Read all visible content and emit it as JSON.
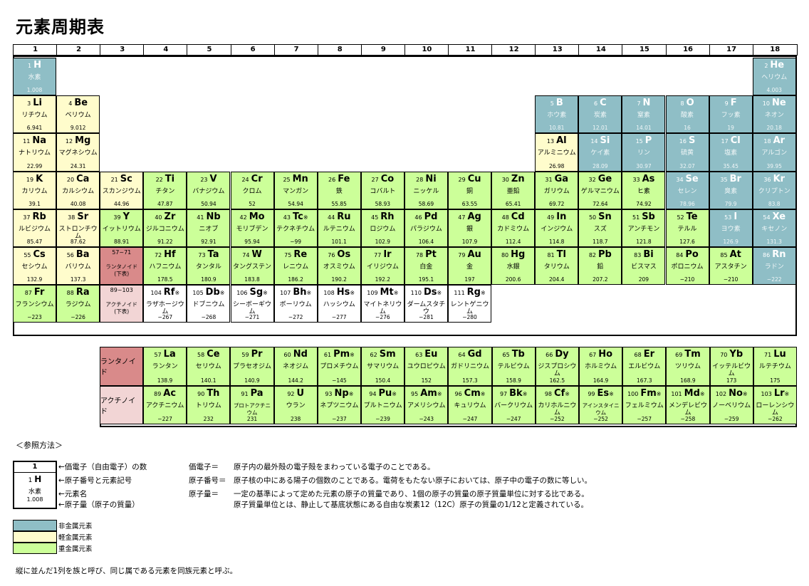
{
  "title": "元素周期表",
  "groups": [
    "1",
    "2",
    "3",
    "4",
    "5",
    "6",
    "7",
    "8",
    "9",
    "10",
    "11",
    "12",
    "13",
    "14",
    "15",
    "16",
    "17",
    "18"
  ],
  "main_elements": [
    {
      "n": "1",
      "s": "H",
      "name": "水素",
      "mass": "1.008",
      "cat": "nonmetal",
      "r": 0,
      "c": 0
    },
    {
      "n": "2",
      "s": "He",
      "name": "ヘリウム",
      "mass": "4.003",
      "cat": "nonmetal",
      "r": 0,
      "c": 17
    },
    {
      "n": "3",
      "s": "Li",
      "name": "リチウム",
      "mass": "6.941",
      "cat": "light",
      "r": 1,
      "c": 0
    },
    {
      "n": "4",
      "s": "Be",
      "name": "ベリウム",
      "mass": "9.012",
      "cat": "light",
      "r": 1,
      "c": 1
    },
    {
      "n": "5",
      "s": "B",
      "name": "ホウ素",
      "mass": "10.81",
      "cat": "nonmetal",
      "r": 1,
      "c": 12
    },
    {
      "n": "6",
      "s": "C",
      "name": "炭素",
      "mass": "12.01",
      "cat": "nonmetal",
      "r": 1,
      "c": 13
    },
    {
      "n": "7",
      "s": "N",
      "name": "窒素",
      "mass": "14.01",
      "cat": "nonmetal",
      "r": 1,
      "c": 14
    },
    {
      "n": "8",
      "s": "O",
      "name": "酸素",
      "mass": "16",
      "cat": "nonmetal",
      "r": 1,
      "c": 15
    },
    {
      "n": "9",
      "s": "F",
      "name": "フッ素",
      "mass": "19",
      "cat": "nonmetal",
      "r": 1,
      "c": 16
    },
    {
      "n": "10",
      "s": "Ne",
      "name": "ネオン",
      "mass": "20.18",
      "cat": "nonmetal",
      "r": 1,
      "c": 17
    },
    {
      "n": "11",
      "s": "Na",
      "name": "ナトリウム",
      "mass": "22.99",
      "cat": "light",
      "r": 2,
      "c": 0
    },
    {
      "n": "12",
      "s": "Mg",
      "name": "マグネシウム",
      "mass": "24.31",
      "cat": "light",
      "r": 2,
      "c": 1
    },
    {
      "n": "13",
      "s": "Al",
      "name": "アルミニウム",
      "mass": "26.98",
      "cat": "light",
      "r": 2,
      "c": 12
    },
    {
      "n": "14",
      "s": "Si",
      "name": "ケイ素",
      "mass": "28.09",
      "cat": "nonmetal",
      "r": 2,
      "c": 13
    },
    {
      "n": "15",
      "s": "P",
      "name": "リン",
      "mass": "30.97",
      "cat": "nonmetal",
      "r": 2,
      "c": 14
    },
    {
      "n": "16",
      "s": "S",
      "name": "硫黄",
      "mass": "32.07",
      "cat": "nonmetal",
      "r": 2,
      "c": 15
    },
    {
      "n": "17",
      "s": "Cl",
      "name": "塩素",
      "mass": "35.45",
      "cat": "nonmetal",
      "r": 2,
      "c": 16
    },
    {
      "n": "18",
      "s": "Ar",
      "name": "アルゴン",
      "mass": "39.95",
      "cat": "nonmetal",
      "r": 2,
      "c": 17
    },
    {
      "n": "19",
      "s": "K",
      "name": "カリウム",
      "mass": "39.1",
      "cat": "light",
      "r": 3,
      "c": 0
    },
    {
      "n": "20",
      "s": "Ca",
      "name": "カルシウム",
      "mass": "40.08",
      "cat": "light",
      "r": 3,
      "c": 1
    },
    {
      "n": "21",
      "s": "Sc",
      "name": "スカンジウム",
      "mass": "44.96",
      "cat": "light",
      "r": 3,
      "c": 2
    },
    {
      "n": "22",
      "s": "Ti",
      "name": "チタン",
      "mass": "47.87",
      "cat": "heavy",
      "r": 3,
      "c": 3
    },
    {
      "n": "23",
      "s": "V",
      "name": "バナジウム",
      "mass": "50.94",
      "cat": "heavy",
      "r": 3,
      "c": 4
    },
    {
      "n": "24",
      "s": "Cr",
      "name": "クロム",
      "mass": "52",
      "cat": "heavy",
      "r": 3,
      "c": 5
    },
    {
      "n": "25",
      "s": "Mn",
      "name": "マンガン",
      "mass": "54.94",
      "cat": "heavy",
      "r": 3,
      "c": 6
    },
    {
      "n": "26",
      "s": "Fe",
      "name": "鉄",
      "mass": "55.85",
      "cat": "heavy",
      "r": 3,
      "c": 7
    },
    {
      "n": "27",
      "s": "Co",
      "name": "コバルト",
      "mass": "58.93",
      "cat": "heavy",
      "r": 3,
      "c": 8
    },
    {
      "n": "28",
      "s": "Ni",
      "name": "ニッケル",
      "mass": "58.69",
      "cat": "heavy",
      "r": 3,
      "c": 9
    },
    {
      "n": "29",
      "s": "Cu",
      "name": "銅",
      "mass": "63.55",
      "cat": "heavy",
      "r": 3,
      "c": 10
    },
    {
      "n": "30",
      "s": "Zn",
      "name": "亜鉛",
      "mass": "65.41",
      "cat": "heavy",
      "r": 3,
      "c": 11
    },
    {
      "n": "31",
      "s": "Ga",
      "name": "ガリウム",
      "mass": "69.72",
      "cat": "heavy",
      "r": 3,
      "c": 12
    },
    {
      "n": "32",
      "s": "Ge",
      "name": "ゲルマニウム",
      "mass": "72.64",
      "cat": "heavy",
      "r": 3,
      "c": 13
    },
    {
      "n": "33",
      "s": "As",
      "name": "ヒ素",
      "mass": "74.92",
      "cat": "heavy",
      "r": 3,
      "c": 14
    },
    {
      "n": "34",
      "s": "Se",
      "name": "セレン",
      "mass": "78.96",
      "cat": "nonmetal",
      "r": 3,
      "c": 15
    },
    {
      "n": "35",
      "s": "Br",
      "name": "臭素",
      "mass": "79.9",
      "cat": "nonmetal",
      "r": 3,
      "c": 16
    },
    {
      "n": "36",
      "s": "Kr",
      "name": "クリプトン",
      "mass": "83.8",
      "cat": "nonmetal",
      "r": 3,
      "c": 17
    },
    {
      "n": "37",
      "s": "Rb",
      "name": "ルビジウム",
      "mass": "85.47",
      "cat": "light",
      "r": 4,
      "c": 0
    },
    {
      "n": "38",
      "s": "Sr",
      "name": "ストロンチウム",
      "mass": "87.62",
      "cat": "light",
      "r": 4,
      "c": 1
    },
    {
      "n": "39",
      "s": "Y",
      "name": "イットリウム",
      "mass": "88.91",
      "cat": "heavy",
      "r": 4,
      "c": 2
    },
    {
      "n": "40",
      "s": "Zr",
      "name": "ジルコニウム",
      "mass": "91.22",
      "cat": "heavy",
      "r": 4,
      "c": 3
    },
    {
      "n": "41",
      "s": "Nb",
      "name": "ニオブ",
      "mass": "92.91",
      "cat": "heavy",
      "r": 4,
      "c": 4
    },
    {
      "n": "42",
      "s": "Mo",
      "name": "モリブデン",
      "mass": "95.94",
      "cat": "heavy",
      "r": 4,
      "c": 5
    },
    {
      "n": "43",
      "s": "Tc",
      "mark": "※",
      "name": "テクネチウム",
      "mass": "−99",
      "cat": "heavy",
      "r": 4,
      "c": 6
    },
    {
      "n": "44",
      "s": "Ru",
      "name": "ルテニウム",
      "mass": "101.1",
      "cat": "heavy",
      "r": 4,
      "c": 7
    },
    {
      "n": "45",
      "s": "Rh",
      "name": "ロジウム",
      "mass": "102.9",
      "cat": "heavy",
      "r": 4,
      "c": 8
    },
    {
      "n": "46",
      "s": "Pd",
      "name": "パラジウム",
      "mass": "106.4",
      "cat": "heavy",
      "r": 4,
      "c": 9
    },
    {
      "n": "47",
      "s": "Ag",
      "name": "銀",
      "mass": "107.9",
      "cat": "heavy",
      "r": 4,
      "c": 10
    },
    {
      "n": "48",
      "s": "Cd",
      "name": "カドミウム",
      "mass": "112.4",
      "cat": "heavy",
      "r": 4,
      "c": 11
    },
    {
      "n": "49",
      "s": "In",
      "name": "インジウム",
      "mass": "114.8",
      "cat": "heavy",
      "r": 4,
      "c": 12
    },
    {
      "n": "50",
      "s": "Sn",
      "name": "スズ",
      "mass": "118.7",
      "cat": "heavy",
      "r": 4,
      "c": 13
    },
    {
      "n": "51",
      "s": "Sb",
      "name": "アンチモン",
      "mass": "121.8",
      "cat": "heavy",
      "r": 4,
      "c": 14
    },
    {
      "n": "52",
      "s": "Te",
      "name": "テルル",
      "mass": "127.6",
      "cat": "heavy",
      "r": 4,
      "c": 15
    },
    {
      "n": "53",
      "s": "I",
      "name": "ヨウ素",
      "mass": "126.9",
      "cat": "nonmetal",
      "r": 4,
      "c": 16
    },
    {
      "n": "54",
      "s": "Xe",
      "name": "キセノン",
      "mass": "131.3",
      "cat": "nonmetal",
      "r": 4,
      "c": 17
    },
    {
      "n": "55",
      "s": "Cs",
      "name": "セシウム",
      "mass": "132.9",
      "cat": "light",
      "r": 5,
      "c": 0
    },
    {
      "n": "56",
      "s": "Ba",
      "name": "バリウム",
      "mass": "137.3",
      "cat": "light",
      "r": 5,
      "c": 1
    },
    {
      "n": "57~71",
      "s": "",
      "name": "ランタノイド\n(下表)",
      "mass": "",
      "cat": "lan",
      "r": 5,
      "c": 2
    },
    {
      "n": "72",
      "s": "Hf",
      "name": "ハフニウム",
      "mass": "178.5",
      "cat": "heavy",
      "r": 5,
      "c": 3
    },
    {
      "n": "73",
      "s": "Ta",
      "name": "タンタル",
      "mass": "180.9",
      "cat": "heavy",
      "r": 5,
      "c": 4
    },
    {
      "n": "74",
      "s": "W",
      "name": "タングステン",
      "mass": "183.8",
      "cat": "heavy",
      "r": 5,
      "c": 5
    },
    {
      "n": "75",
      "s": "Re",
      "name": "レニウム",
      "mass": "186.2",
      "cat": "heavy",
      "r": 5,
      "c": 6
    },
    {
      "n": "76",
      "s": "Os",
      "name": "オスミウム",
      "mass": "190.2",
      "cat": "heavy",
      "r": 5,
      "c": 7
    },
    {
      "n": "77",
      "s": "Ir",
      "name": "イリジウム",
      "mass": "192.2",
      "cat": "heavy",
      "r": 5,
      "c": 8
    },
    {
      "n": "78",
      "s": "Pt",
      "name": "白金",
      "mass": "195.1",
      "cat": "heavy",
      "r": 5,
      "c": 9
    },
    {
      "n": "79",
      "s": "Au",
      "name": "金",
      "mass": "197",
      "cat": "heavy",
      "r": 5,
      "c": 10
    },
    {
      "n": "80",
      "s": "Hg",
      "name": "水銀",
      "mass": "200.6",
      "cat": "heavy",
      "r": 5,
      "c": 11
    },
    {
      "n": "81",
      "s": "Tl",
      "name": "タリウム",
      "mass": "204.4",
      "cat": "heavy",
      "r": 5,
      "c": 12
    },
    {
      "n": "82",
      "s": "Pb",
      "name": "鉛",
      "mass": "207.2",
      "cat": "heavy",
      "r": 5,
      "c": 13
    },
    {
      "n": "83",
      "s": "Bi",
      "name": "ビスマス",
      "mass": "209",
      "cat": "heavy",
      "r": 5,
      "c": 14
    },
    {
      "n": "84",
      "s": "Po",
      "name": "ポロニウム",
      "mass": "−210",
      "cat": "heavy",
      "r": 5,
      "c": 15
    },
    {
      "n": "85",
      "s": "At",
      "name": "アスタチン",
      "mass": "−210",
      "cat": "heavy",
      "r": 5,
      "c": 16
    },
    {
      "n": "86",
      "s": "Rn",
      "name": "ラドン",
      "mass": "−222",
      "cat": "nonmetal",
      "r": 5,
      "c": 17
    },
    {
      "n": "87",
      "s": "Fr",
      "name": "フランシウム",
      "mass": "−223",
      "cat": "heavy",
      "r": 6,
      "c": 0
    },
    {
      "n": "88",
      "s": "Ra",
      "name": "ラジウム",
      "mass": "−226",
      "cat": "heavy",
      "r": 6,
      "c": 1
    },
    {
      "n": "89~103",
      "s": "",
      "name": "アクチノイド\n(下表)",
      "mass": "",
      "cat": "act",
      "r": 6,
      "c": 2
    },
    {
      "n": "104",
      "s": "Rf",
      "mark": "※",
      "name": "ラザホージウム",
      "mass": "−267",
      "cat": "white",
      "r": 6,
      "c": 3
    },
    {
      "n": "105",
      "s": "Db",
      "mark": "※",
      "name": "ドブニウム",
      "mass": "−268",
      "cat": "white",
      "r": 6,
      "c": 4
    },
    {
      "n": "106",
      "s": "Sg",
      "mark": "※",
      "name": "シーボーギウム",
      "mass": "−271",
      "cat": "white",
      "r": 6,
      "c": 5
    },
    {
      "n": "107",
      "s": "Bh",
      "mark": "※",
      "name": "ボーリウム",
      "mass": "−272",
      "cat": "white",
      "r": 6,
      "c": 6
    },
    {
      "n": "108",
      "s": "Hs",
      "mark": "※",
      "name": "ハッシウム",
      "mass": "−277",
      "cat": "white",
      "r": 6,
      "c": 7
    },
    {
      "n": "109",
      "s": "Mt",
      "mark": "※",
      "name": "マイトネリウム",
      "mass": "−276",
      "cat": "white",
      "r": 6,
      "c": 8
    },
    {
      "n": "110",
      "s": "Ds",
      "mark": "※",
      "name": "ダームスタチウ",
      "mass": "−281",
      "cat": "white",
      "r": 6,
      "c": 9
    },
    {
      "n": "111",
      "s": "Rg",
      "mark": "※",
      "name": "レントゲニウム",
      "mass": "−280",
      "cat": "white",
      "r": 6,
      "c": 10
    }
  ],
  "series_labels": [
    "ランタノイド",
    "アクチノイド"
  ],
  "lanthanides": [
    {
      "n": "57",
      "s": "La",
      "name": "ランタン",
      "mass": "138.9"
    },
    {
      "n": "58",
      "s": "Ce",
      "name": "セリウム",
      "mass": "140.1"
    },
    {
      "n": "59",
      "s": "Pr",
      "name": "プラセオジム",
      "mass": "140.9"
    },
    {
      "n": "60",
      "s": "Nd",
      "name": "ネオジム",
      "mass": "144.2"
    },
    {
      "n": "61",
      "s": "Pm",
      "mark": "※",
      "name": "プロメチウム",
      "mass": "−145"
    },
    {
      "n": "62",
      "s": "Sm",
      "name": "サマリウム",
      "mass": "150.4"
    },
    {
      "n": "63",
      "s": "Eu",
      "name": "ユウロピウム",
      "mass": "152"
    },
    {
      "n": "64",
      "s": "Gd",
      "name": "ガドリニウム",
      "mass": "157.3"
    },
    {
      "n": "65",
      "s": "Tb",
      "name": "テルビウム",
      "mass": "158.9"
    },
    {
      "n": "66",
      "s": "Dy",
      "name": "ジスプロシウム",
      "mass": "162.5"
    },
    {
      "n": "67",
      "s": "Ho",
      "name": "ホルミウム",
      "mass": "164.9"
    },
    {
      "n": "68",
      "s": "Er",
      "name": "エルビウム",
      "mass": "167.3"
    },
    {
      "n": "69",
      "s": "Tm",
      "name": "ツリウム",
      "mass": "168.9"
    },
    {
      "n": "70",
      "s": "Yb",
      "name": "イッテルビウム",
      "mass": "173"
    },
    {
      "n": "71",
      "s": "Lu",
      "name": "ルテチウム",
      "mass": "175"
    }
  ],
  "actinides": [
    {
      "n": "89",
      "s": "Ac",
      "name": "アクチニウム",
      "mass": "−227"
    },
    {
      "n": "90",
      "s": "Th",
      "name": "トリウム",
      "mass": "232"
    },
    {
      "n": "91",
      "s": "Pa",
      "name": "プロトアクチニウム",
      "mass": "231"
    },
    {
      "n": "92",
      "s": "U",
      "name": "ウラン",
      "mass": "238"
    },
    {
      "n": "93",
      "s": "Np",
      "mark": "※",
      "name": "ネプツニウム",
      "mass": "−237"
    },
    {
      "n": "94",
      "s": "Pu",
      "mark": "※",
      "name": "プルトニウム",
      "mass": "−239"
    },
    {
      "n": "95",
      "s": "Am",
      "mark": "※",
      "name": "アメリシウム",
      "mass": "−243"
    },
    {
      "n": "96",
      "s": "Cm",
      "mark": "※",
      "name": "キュリウム",
      "mass": "−247"
    },
    {
      "n": "97",
      "s": "Bk",
      "mark": "※",
      "name": "バークリウム",
      "mass": "−247"
    },
    {
      "n": "98",
      "s": "Cf",
      "mark": "※",
      "name": "カリホルニウム",
      "mass": "−252"
    },
    {
      "n": "99",
      "s": "Es",
      "mark": "※",
      "name": "アインスタイニウム",
      "mass": "−252"
    },
    {
      "n": "100",
      "s": "Fm",
      "mark": "※",
      "name": "フェルミウム",
      "mass": "−257"
    },
    {
      "n": "101",
      "s": "Md",
      "mark": "※",
      "name": "メンデレビウム",
      "mass": "−258"
    },
    {
      "n": "102",
      "s": "No",
      "mark": "※",
      "name": "ノーベリウム",
      "mass": "−259"
    },
    {
      "n": "103",
      "s": "Lr",
      "mark": "※",
      "name": "ローレンシウム",
      "mass": "−262"
    }
  ],
  "reference": {
    "title": "＜参照方法＞",
    "key": {
      "group": "1",
      "number": "1",
      "symbol": "H",
      "name": "水素",
      "mass": "1.008"
    },
    "arrows": [
      "←価電子（自由電子）の数",
      "←原子番号と元素記号",
      "←元素名",
      "←原子量（原子の質量）"
    ],
    "definitions": [
      {
        "term": "価電子＝",
        "text": "原子内の最外殻の電子殻をまわっている電子のことである。"
      },
      {
        "term": "原子番号＝",
        "text": "原子核の中にある陽子の個数のことである。電荷をもたない原子においては、原子中の電子の数に等しい。"
      },
      {
        "term": "原子量＝",
        "text": "一定の基準によって定めた元素の原子の質量であり、1個の原子の質量の原子質量単位に対する比である。"
      },
      {
        "term": "",
        "text": "原子質量単位とは、静止して基底状態にある自由な炭素12（12C）原子の質量の1/12と定義されている。"
      }
    ]
  },
  "legend": [
    {
      "label": "非金属元素",
      "color": "#8fbec6"
    },
    {
      "label": "軽金属元素",
      "color": "#fffccc"
    },
    {
      "label": "重金属元素",
      "color": "#ccff99"
    }
  ],
  "footer": "縦に並んだ1列を族と呼び、同じ属である元素を同族元素と呼ぶ。"
}
